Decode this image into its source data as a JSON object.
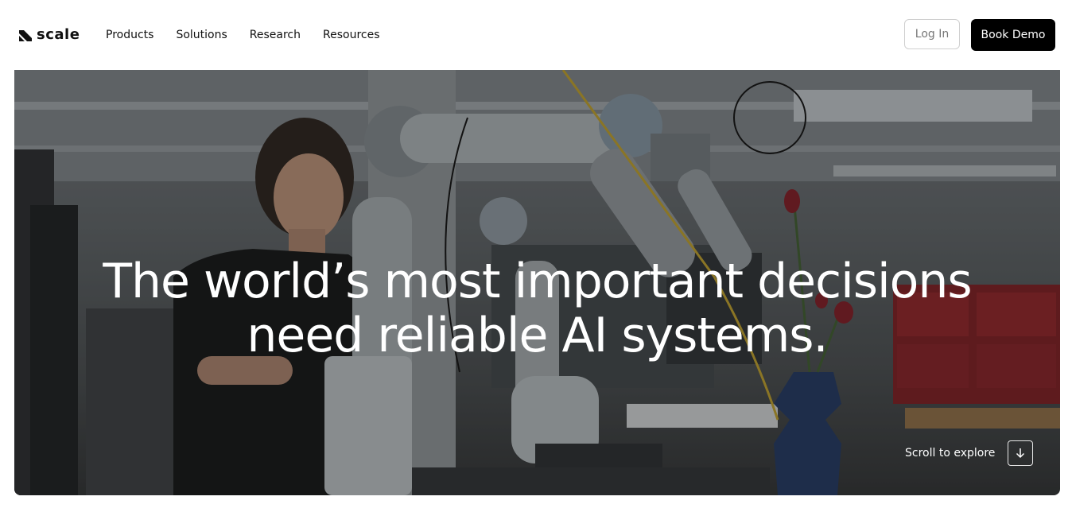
{
  "nav": {
    "logo_text": "scale",
    "menu": [
      {
        "label": "Products"
      },
      {
        "label": "Solutions"
      },
      {
        "label": "Research"
      },
      {
        "label": "Resources"
      }
    ],
    "login_label": "Log In",
    "demo_label": "Book Demo"
  },
  "hero": {
    "title_line1": "The world’s most important decisions",
    "title_line2": "need reliable AI systems.",
    "scroll_label": "Scroll to explore",
    "scroll_icon": "arrow-down-icon",
    "image_desc_icon": "robot-arm-lab-photo"
  },
  "colors": {
    "primary": "#000000",
    "background": "#ffffff",
    "hero_text": "#ffffff",
    "accent_red": "#8c1f22"
  }
}
